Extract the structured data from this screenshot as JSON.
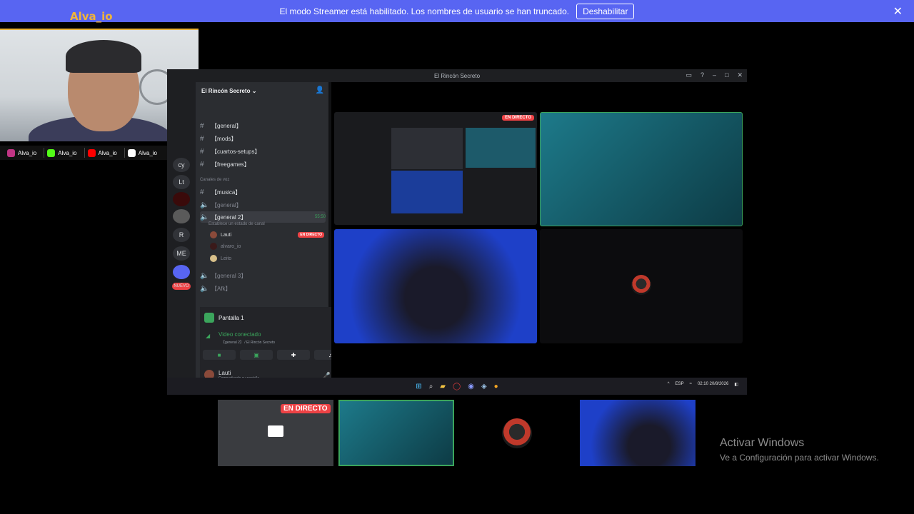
{
  "banner": {
    "message": "El modo Streamer está habilitado. Los nombres de usuario se han truncado.",
    "button": "Deshabilitar",
    "close": "✕"
  },
  "overlay": {
    "name": "Alva_io",
    "socials": [
      {
        "name": "Alva_io",
        "color": "#c13584"
      },
      {
        "name": "Alva_io",
        "color": "#53fc18"
      },
      {
        "name": "Alva_io",
        "color": "#ff0000"
      },
      {
        "name": "Alva_io",
        "color": "#ffffff"
      }
    ]
  },
  "window": {
    "title": "El Rincón Secreto",
    "server_name": "El Rincón Secreto",
    "servers": [
      "cy",
      "Lt",
      "R",
      "ME"
    ],
    "nuevo": "NUEVO",
    "text_channels": [
      "【general】",
      "【mods】",
      "【cuartos-setups】",
      "【freegames】"
    ],
    "voice_category": "Canales de voz",
    "voice_channels": {
      "musica": "【musica】",
      "general": "【general】",
      "general2": "【general 2】",
      "general2_time": "55:50",
      "general2_status": "Establece un estado de canal",
      "general3": "【general 3】",
      "afk": "【Afk】"
    },
    "voice_users": [
      {
        "name": "Lauti",
        "live": "EN DIRECTO"
      },
      {
        "name": "alvaro_io",
        "live": ""
      },
      {
        "name": "Leito",
        "live": ""
      }
    ],
    "screen_panel": "Pantalla 1",
    "voice_connected": "Video conectado",
    "voice_location": "【general 2】 / El Rincón Secreto",
    "user_panel": {
      "name": "Lauti",
      "status": "Compartiendo su pantalla"
    },
    "live_badge": "EN DIRECTO"
  },
  "taskbar": {
    "lang": "ESP",
    "time": "02:10",
    "date": "20/8/2026"
  },
  "bottom": {
    "live": "EN DIRECTO"
  },
  "activation": {
    "title": "Activar Windows",
    "subtitle": "Ve a Configuración para activar Windows."
  }
}
